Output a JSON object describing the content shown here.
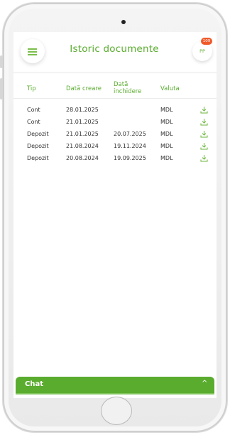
{
  "header": {
    "title": "Istoric documente",
    "avatar_initials": "PP",
    "notification_count": "109"
  },
  "table": {
    "columns": [
      "Tip",
      "Dată creare",
      "Dată\ninchidere",
      "Valuta"
    ],
    "rows": [
      {
        "tip": "Cont",
        "creare": "28.01.2025",
        "inchidere": "",
        "valuta": "MDL"
      },
      {
        "tip": "Cont",
        "creare": "21.01.2025",
        "inchidere": "",
        "valuta": "MDL"
      },
      {
        "tip": "Depozit",
        "creare": "21.01.2025",
        "inchidere": "20.07.2025",
        "valuta": "MDL"
      },
      {
        "tip": "Depozit",
        "creare": "21.08.2024",
        "inchidere": "19.11.2024",
        "valuta": "MDL"
      },
      {
        "tip": "Depozit",
        "creare": "20.08.2024",
        "inchidere": "19.09.2025",
        "valuta": "MDL"
      }
    ]
  },
  "chat": {
    "label": "Chat",
    "chevron": "^"
  },
  "colors": {
    "accent": "#5aac2f",
    "badge": "#f0592a"
  }
}
